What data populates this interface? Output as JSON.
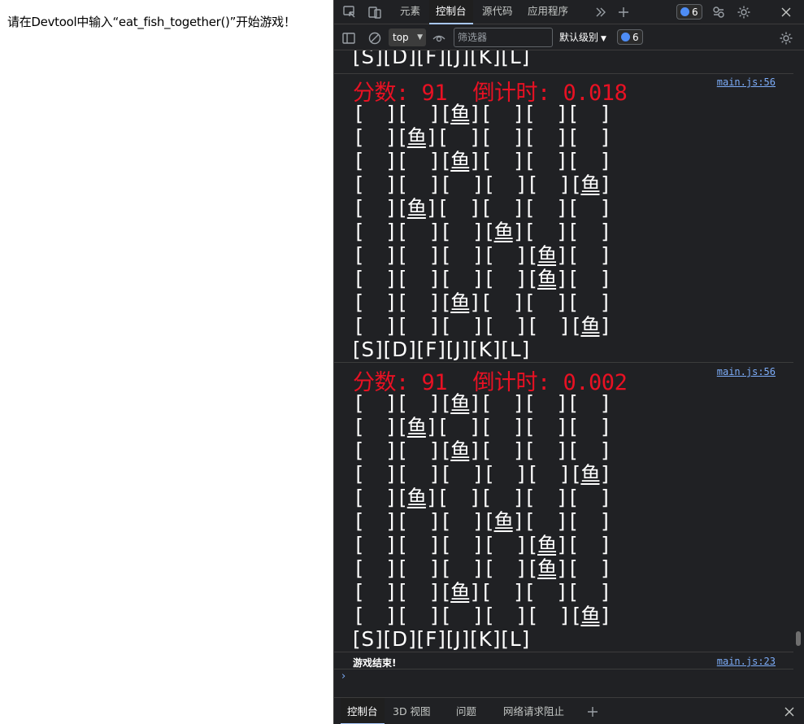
{
  "page": {
    "text": "请在Devtool中输入“eat_fish_together()”开始游戏！"
  },
  "devtools": {
    "tabs": [
      "元素",
      "控制台",
      "源代码",
      "应用程序"
    ],
    "active_tab": "控制台",
    "issues_badge": "6",
    "toolbar": {
      "context": "top",
      "filter_placeholder": "筛选器",
      "level": "默认级别",
      "badge": "6"
    },
    "drawer_tabs": [
      "控制台",
      "3D 视图",
      "问题",
      "网络请求阻止"
    ],
    "icons": {
      "inspect": "inspect-element-icon",
      "device": "device-toolbar-icon",
      "more_tabs": "more-tabs-icon",
      "add_tab": "add-tab-icon",
      "issues": "issues-icon",
      "customize": "customize-icon",
      "settings": "settings-gear-icon",
      "close": "close-icon",
      "sidebar": "sidebar-toggle-icon",
      "clear": "clear-console-icon",
      "eye": "live-expression-icon"
    },
    "colors": {
      "score": "#e81123",
      "link": "#7cacf8",
      "accent": "#a8c7fa"
    }
  },
  "console": {
    "top_keys_line": "[S][D][F][J][K][L]",
    "blocks": [
      {
        "score_line": "分数: 91  倒计时: 0.018",
        "source": "main.js:56",
        "rows": [
          2,
          1,
          2,
          5,
          1,
          3,
          4,
          4,
          2,
          5
        ],
        "keys_line": "[S][D][F][J][K][L]"
      },
      {
        "score_line": "分数: 91  倒计时: 0.002",
        "source": "main.js:56",
        "rows": [
          2,
          1,
          2,
          5,
          1,
          3,
          4,
          4,
          2,
          5
        ],
        "keys_line": "[S][D][F][J][K][L]"
      }
    ],
    "fish": "鱼",
    "end_message": "游戏结束!",
    "end_source": "main.js:23"
  }
}
